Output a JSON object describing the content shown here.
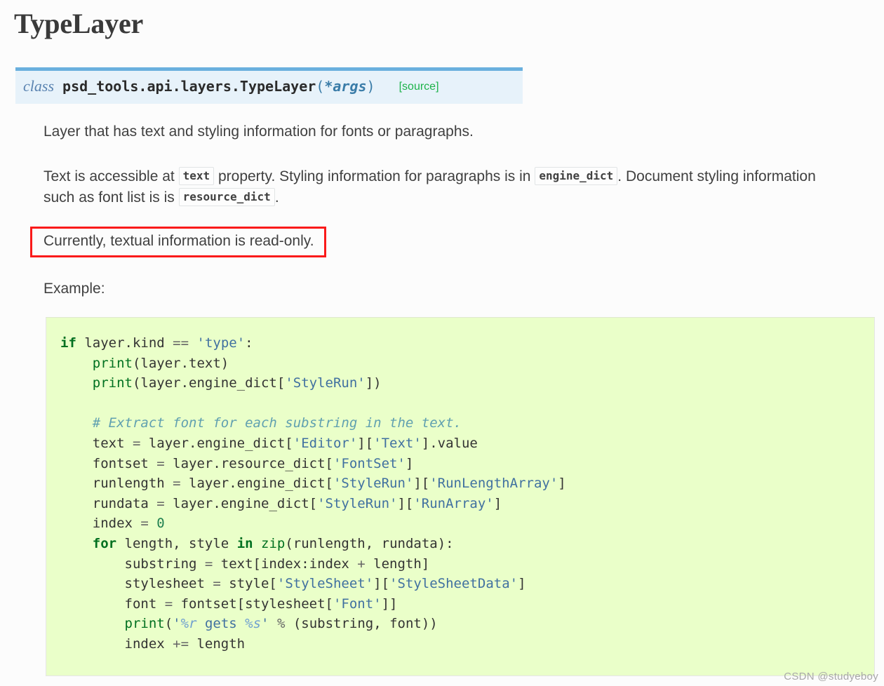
{
  "page": {
    "title": "TypeLayer",
    "background_color": "#fcfcfc"
  },
  "signature": {
    "keyword": "class",
    "qualified_name": "psd_tools.api.layers.TypeLayer",
    "open_paren": "(",
    "args": "*args",
    "close_paren": ")",
    "source_link": "[source]",
    "background_color": "#e7f2fa",
    "border_color": "#6ab0de",
    "source_link_color": "#1db34a"
  },
  "description": {
    "paragraph1": "Layer that has text and styling information for fonts or paragraphs.",
    "paragraph2_part1": "Text is accessible at",
    "paragraph2_code1": "text",
    "paragraph2_part2": "property. Styling information for paragraphs is in",
    "paragraph2_code2": "engine_dict",
    "paragraph2_part3": ".",
    "paragraph2_part4": "Document styling information such as font list is is",
    "paragraph2_code3": "resource_dict",
    "paragraph2_part5": "."
  },
  "highlight": {
    "text": "Currently, textual information is read-only.",
    "border_color": "#fa1a1a"
  },
  "example_label": "Example:",
  "code_block": {
    "language": "python",
    "background_color": "#eaffc9",
    "lines": [
      [
        {
          "t": "if",
          "c": "k"
        },
        {
          "t": " layer.kind ",
          "c": "n"
        },
        {
          "t": "==",
          "c": "o"
        },
        {
          "t": " ",
          "c": "n"
        },
        {
          "t": "'type'",
          "c": "s"
        },
        {
          "t": ":",
          "c": "n"
        }
      ],
      [
        {
          "t": "    ",
          "c": "n"
        },
        {
          "t": "print",
          "c": "nb"
        },
        {
          "t": "(layer.text)",
          "c": "n"
        }
      ],
      [
        {
          "t": "    ",
          "c": "n"
        },
        {
          "t": "print",
          "c": "nb"
        },
        {
          "t": "(layer.engine_dict[",
          "c": "n"
        },
        {
          "t": "'StyleRun'",
          "c": "s"
        },
        {
          "t": "])",
          "c": "n"
        }
      ],
      [],
      [
        {
          "t": "    ",
          "c": "n"
        },
        {
          "t": "# Extract font for each substring in the text.",
          "c": "c"
        }
      ],
      [
        {
          "t": "    text ",
          "c": "n"
        },
        {
          "t": "=",
          "c": "o"
        },
        {
          "t": " layer.engine_dict[",
          "c": "n"
        },
        {
          "t": "'Editor'",
          "c": "s"
        },
        {
          "t": "][",
          "c": "n"
        },
        {
          "t": "'Text'",
          "c": "s"
        },
        {
          "t": "].value",
          "c": "n"
        }
      ],
      [
        {
          "t": "    fontset ",
          "c": "n"
        },
        {
          "t": "=",
          "c": "o"
        },
        {
          "t": " layer.resource_dict[",
          "c": "n"
        },
        {
          "t": "'FontSet'",
          "c": "s"
        },
        {
          "t": "]",
          "c": "n"
        }
      ],
      [
        {
          "t": "    runlength ",
          "c": "n"
        },
        {
          "t": "=",
          "c": "o"
        },
        {
          "t": " layer.engine_dict[",
          "c": "n"
        },
        {
          "t": "'StyleRun'",
          "c": "s"
        },
        {
          "t": "][",
          "c": "n"
        },
        {
          "t": "'RunLengthArray'",
          "c": "s"
        },
        {
          "t": "]",
          "c": "n"
        }
      ],
      [
        {
          "t": "    rundata ",
          "c": "n"
        },
        {
          "t": "=",
          "c": "o"
        },
        {
          "t": " layer.engine_dict[",
          "c": "n"
        },
        {
          "t": "'StyleRun'",
          "c": "s"
        },
        {
          "t": "][",
          "c": "n"
        },
        {
          "t": "'RunArray'",
          "c": "s"
        },
        {
          "t": "]",
          "c": "n"
        }
      ],
      [
        {
          "t": "    index ",
          "c": "n"
        },
        {
          "t": "=",
          "c": "o"
        },
        {
          "t": " ",
          "c": "n"
        },
        {
          "t": "0",
          "c": "mi"
        }
      ],
      [
        {
          "t": "    ",
          "c": "n"
        },
        {
          "t": "for",
          "c": "k"
        },
        {
          "t": " length, style ",
          "c": "n"
        },
        {
          "t": "in",
          "c": "k"
        },
        {
          "t": " ",
          "c": "n"
        },
        {
          "t": "zip",
          "c": "nb"
        },
        {
          "t": "(runlength, rundata):",
          "c": "n"
        }
      ],
      [
        {
          "t": "        substring ",
          "c": "n"
        },
        {
          "t": "=",
          "c": "o"
        },
        {
          "t": " text[index:index ",
          "c": "n"
        },
        {
          "t": "+",
          "c": "o"
        },
        {
          "t": " length]",
          "c": "n"
        }
      ],
      [
        {
          "t": "        stylesheet ",
          "c": "n"
        },
        {
          "t": "=",
          "c": "o"
        },
        {
          "t": " style[",
          "c": "n"
        },
        {
          "t": "'StyleSheet'",
          "c": "s"
        },
        {
          "t": "][",
          "c": "n"
        },
        {
          "t": "'StyleSheetData'",
          "c": "s"
        },
        {
          "t": "]",
          "c": "n"
        }
      ],
      [
        {
          "t": "        font ",
          "c": "n"
        },
        {
          "t": "=",
          "c": "o"
        },
        {
          "t": " fontset[stylesheet[",
          "c": "n"
        },
        {
          "t": "'Font'",
          "c": "s"
        },
        {
          "t": "]]",
          "c": "n"
        }
      ],
      [
        {
          "t": "        ",
          "c": "n"
        },
        {
          "t": "print",
          "c": "nb"
        },
        {
          "t": "(",
          "c": "n"
        },
        {
          "t": "'",
          "c": "s"
        },
        {
          "t": "%r",
          "c": "si"
        },
        {
          "t": " gets ",
          "c": "s"
        },
        {
          "t": "%s",
          "c": "si"
        },
        {
          "t": "'",
          "c": "s"
        },
        {
          "t": " ",
          "c": "n"
        },
        {
          "t": "%",
          "c": "o"
        },
        {
          "t": " (substring, font))",
          "c": "n"
        }
      ],
      [
        {
          "t": "        index ",
          "c": "n"
        },
        {
          "t": "+=",
          "c": "o"
        },
        {
          "t": " length",
          "c": "n"
        }
      ]
    ]
  },
  "watermark": {
    "text": "CSDN @studyeboy"
  }
}
